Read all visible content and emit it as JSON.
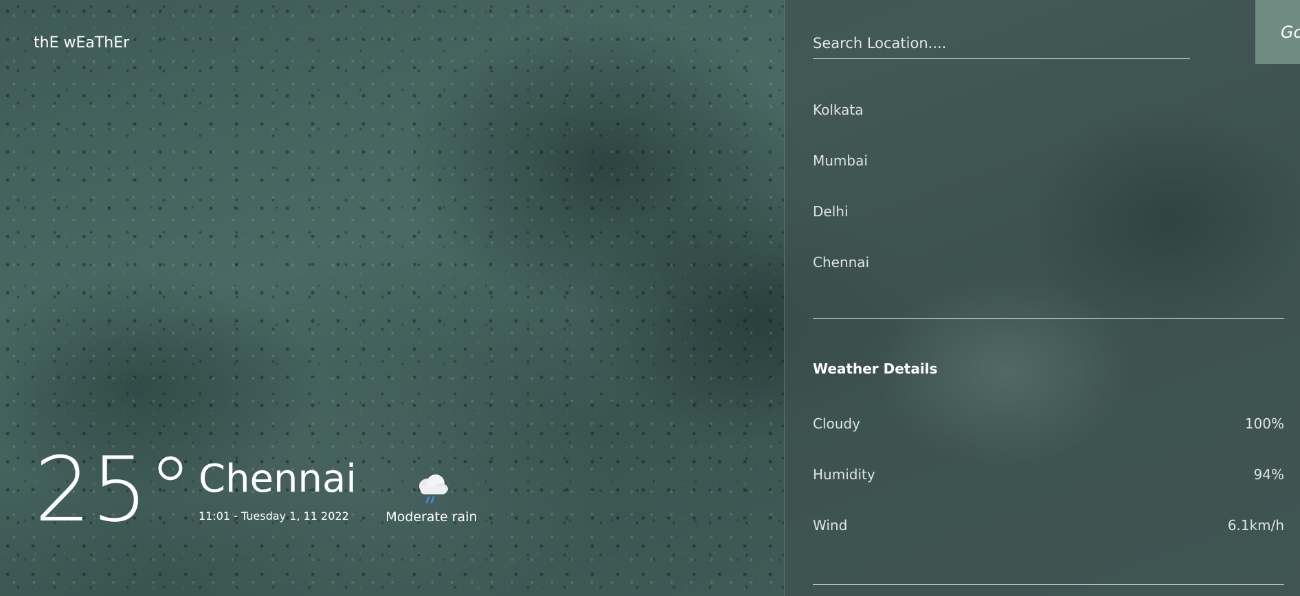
{
  "brand": {
    "title": "thE wEaThEr"
  },
  "current": {
    "temperature": "25°",
    "city": "Chennai",
    "datetime": "11:01 - Tuesday 1, 11 2022",
    "condition": "Moderate rain",
    "condition_icon": "cloud-rain-icon"
  },
  "search": {
    "placeholder": "Search Location....",
    "value": "",
    "button_label": "Go"
  },
  "locations": [
    {
      "label": "Kolkata"
    },
    {
      "label": "Mumbai"
    },
    {
      "label": "Delhi"
    },
    {
      "label": "Chennai"
    }
  ],
  "details": {
    "title": "Weather Details",
    "rows": [
      {
        "label": "Cloudy",
        "value": "100%"
      },
      {
        "label": "Humidity",
        "value": "94%"
      },
      {
        "label": "Wind",
        "value": "6.1km/h"
      }
    ]
  },
  "colors": {
    "go_button": "#6f8b82",
    "rain_accent": "#3a8ee6",
    "background": "#4b6964"
  }
}
